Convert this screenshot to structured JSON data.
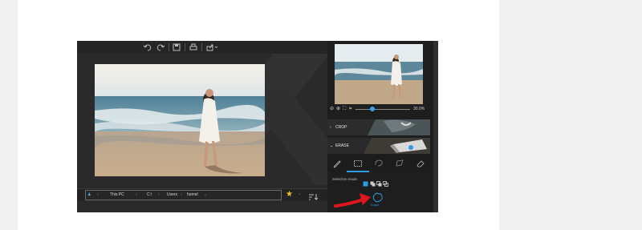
{
  "toolbar": {
    "undo_icon": "undo-icon",
    "redo_icon": "redo-icon",
    "save_icon": "save-icon",
    "print_icon": "print-icon",
    "share_icon": "share-icon"
  },
  "pathbar": {
    "segments": [
      "This PC",
      "C:\\",
      "Users",
      "homel"
    ],
    "favorite_color": "#f2c12e"
  },
  "sidepanel": {
    "zoom_percent": "30.0%",
    "sections": [
      {
        "label": "CROP"
      },
      {
        "label": "ERASE"
      }
    ],
    "selection_mode_label": "Selection mode",
    "erase_button_label": "Erase",
    "accent_color": "#2f9be0"
  },
  "annotation": {
    "arrow_color": "#e0161e"
  }
}
